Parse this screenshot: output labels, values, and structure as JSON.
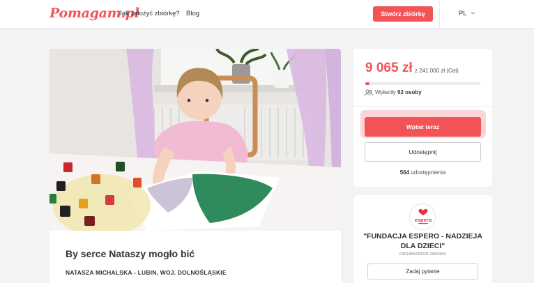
{
  "header": {
    "logo": "Pomagam.pl",
    "nav": [
      "Jak założyć zbiórkę?",
      "Blog"
    ],
    "create_button": "Stwórz zbiórkę",
    "language": "PL"
  },
  "fundraiser": {
    "title": "By serce Nataszy mogło bić",
    "location": "NATASZA MICHALSKA - LUBIN, WOJ. DOLNOŚLĄSKIE"
  },
  "donation": {
    "raised": "9 065 zł",
    "goal_text": "z 241 000 zł (Cel)",
    "progress_fraction": 0.038,
    "donors_prefix": "Wpłaciły",
    "donors_count": "92 osoby",
    "pay_button": "Wpłać teraz",
    "share_button": "Udostępnij",
    "shares_count": "564",
    "shares_label": "udostępnienia"
  },
  "organizer": {
    "logo_text": "espero",
    "name": "\"FUNDACJA ESPERO - NADZIEJA DLA DZIECI\"",
    "role": "ORGANIZATOR ZBIÓRKI",
    "ask_button": "Zadaj pytanie"
  },
  "colors": {
    "accent": "#f2555a",
    "background": "#f3f3f3"
  }
}
